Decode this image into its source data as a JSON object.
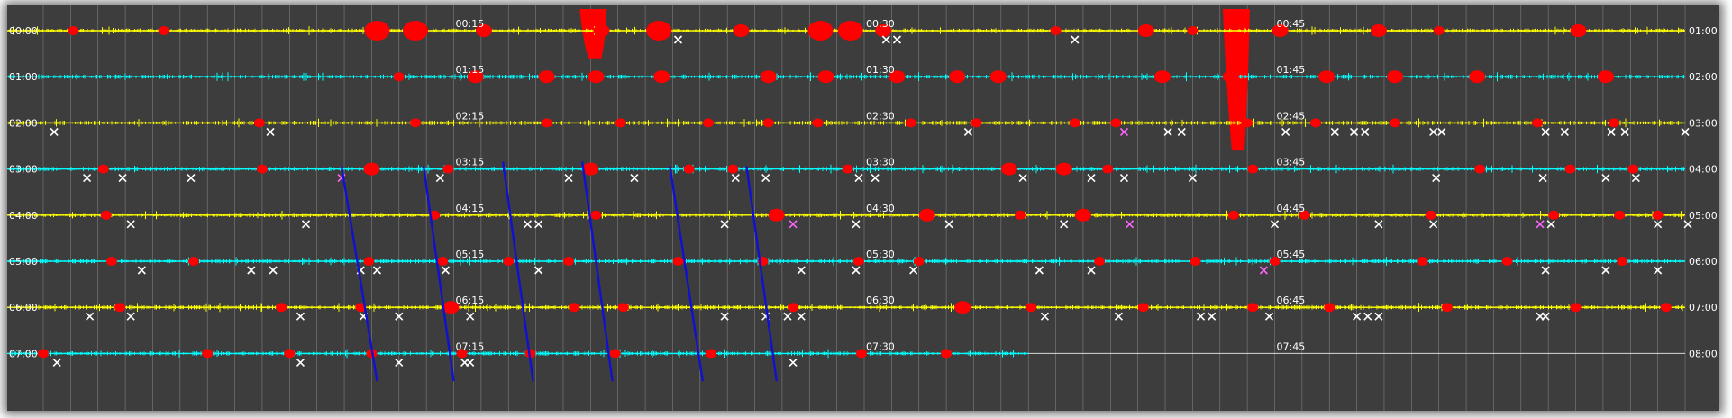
{
  "chart_data": {
    "type": "helicorder",
    "title": "",
    "left_labels": [
      "00:00",
      "01:00",
      "02:00",
      "03:00",
      "04:00",
      "05:00",
      "06:00",
      "07:00"
    ],
    "right_labels": [
      "01:00",
      "02:00",
      "03:00",
      "04:00",
      "05:00",
      "06:00",
      "07:00",
      "08:00"
    ],
    "mid_labels": [
      [
        "00:15",
        "00:30",
        "00:45"
      ],
      [
        "01:15",
        "01:30",
        "01:45"
      ],
      [
        "02:15",
        "02:30",
        "02:45"
      ],
      [
        "03:15",
        "03:30",
        "03:45"
      ],
      [
        "04:15",
        "04:30",
        "04:45"
      ],
      [
        "05:15",
        "05:30",
        "05:45"
      ],
      [
        "06:15",
        "06:30",
        "06:45"
      ],
      [
        "07:15",
        "07:30",
        "07:45"
      ]
    ],
    "minutes_per_line": 60,
    "trace_colors": [
      "#ffff00",
      "#00ffff"
    ],
    "event_color": "#ff0000",
    "pick_color": "#ffffff",
    "alt_pick_color": "#ff66ff",
    "line_color": "#1010d0",
    "background": "#3d3d3d",
    "grid": true,
    "last_line_end_minute": 36,
    "picks": [
      [
        [
          23.2,
          "w"
        ],
        [
          30.8,
          "w"
        ],
        [
          31.2,
          "w"
        ],
        [
          37.7,
          "w"
        ]
      ],
      [],
      [
        [
          0.4,
          "w"
        ],
        [
          8.3,
          "w"
        ],
        [
          33.8,
          "w"
        ],
        [
          39.5,
          "m"
        ],
        [
          41.1,
          "w"
        ],
        [
          41.6,
          "w"
        ],
        [
          45.4,
          "w"
        ],
        [
          47.2,
          "w"
        ],
        [
          47.9,
          "w"
        ],
        [
          48.3,
          "w"
        ],
        [
          50.8,
          "w"
        ],
        [
          51.1,
          "w"
        ],
        [
          54.9,
          "w"
        ],
        [
          55.6,
          "w"
        ],
        [
          57.3,
          "w"
        ],
        [
          57.8,
          "w"
        ],
        [
          60.0,
          "w"
        ]
      ],
      [
        [
          1.6,
          "w"
        ],
        [
          2.9,
          "w"
        ],
        [
          5.4,
          "w"
        ],
        [
          10.9,
          "m"
        ],
        [
          14.5,
          "w"
        ],
        [
          19.2,
          "w"
        ],
        [
          21.6,
          "w"
        ],
        [
          25.3,
          "w"
        ],
        [
          26.4,
          "w"
        ],
        [
          29.8,
          "w"
        ],
        [
          30.4,
          "w"
        ],
        [
          35.8,
          "w"
        ],
        [
          38.3,
          "w"
        ],
        [
          39.5,
          "w"
        ],
        [
          42.0,
          "w"
        ],
        [
          50.9,
          "w"
        ],
        [
          54.8,
          "w"
        ],
        [
          57.1,
          "w"
        ],
        [
          58.2,
          "w"
        ]
      ],
      [
        [
          3.2,
          "w"
        ],
        [
          9.6,
          "w"
        ],
        [
          17.7,
          "w"
        ],
        [
          18.1,
          "w"
        ],
        [
          24.9,
          "w"
        ],
        [
          27.4,
          "m"
        ],
        [
          29.7,
          "w"
        ],
        [
          33.1,
          "w"
        ],
        [
          37.3,
          "w"
        ],
        [
          39.7,
          "m"
        ],
        [
          45.0,
          "w"
        ],
        [
          48.8,
          "w"
        ],
        [
          50.8,
          "w"
        ],
        [
          54.7,
          "m"
        ],
        [
          55.1,
          "w"
        ],
        [
          59.0,
          "w"
        ],
        [
          60.1,
          "w"
        ]
      ],
      [
        [
          3.6,
          "w"
        ],
        [
          7.6,
          "w"
        ],
        [
          8.4,
          "w"
        ],
        [
          11.6,
          "w"
        ],
        [
          12.2,
          "w"
        ],
        [
          14.7,
          "w"
        ],
        [
          18.1,
          "w"
        ],
        [
          27.7,
          "w"
        ],
        [
          29.7,
          "w"
        ],
        [
          31.8,
          "w"
        ],
        [
          36.4,
          "w"
        ],
        [
          38.3,
          "w"
        ],
        [
          44.6,
          "m"
        ],
        [
          54.9,
          "w"
        ],
        [
          57.1,
          "w"
        ],
        [
          59.0,
          "w"
        ]
      ],
      [
        [
          1.7,
          "w"
        ],
        [
          3.2,
          "w"
        ],
        [
          9.4,
          "w"
        ],
        [
          11.7,
          "w"
        ],
        [
          13.0,
          "w"
        ],
        [
          15.6,
          "w"
        ],
        [
          24.9,
          "w"
        ],
        [
          26.4,
          "w"
        ],
        [
          27.2,
          "w"
        ],
        [
          27.7,
          "w"
        ],
        [
          36.6,
          "w"
        ],
        [
          39.3,
          "w"
        ],
        [
          42.3,
          "w"
        ],
        [
          42.7,
          "w"
        ],
        [
          44.8,
          "w"
        ],
        [
          48.0,
          "w"
        ],
        [
          48.4,
          "w"
        ],
        [
          48.8,
          "w"
        ],
        [
          54.7,
          "w"
        ],
        [
          54.9,
          "w"
        ]
      ],
      [
        [
          0.5,
          "w"
        ],
        [
          9.4,
          "w"
        ],
        [
          13.0,
          "w"
        ],
        [
          15.4,
          "w"
        ],
        [
          15.6,
          "w"
        ],
        [
          27.4,
          "w"
        ]
      ]
    ],
    "event_markers": [
      [
        [
          1.1,
          "s"
        ],
        [
          4.4,
          "s"
        ],
        [
          12.2,
          "l"
        ],
        [
          13.6,
          "l"
        ],
        [
          16.1,
          "m"
        ],
        [
          20.4,
          "m"
        ],
        [
          22.5,
          "l"
        ],
        [
          25.5,
          "m"
        ],
        [
          28.4,
          "l"
        ],
        [
          29.5,
          "l"
        ],
        [
          30.7,
          "m"
        ],
        [
          37.0,
          "s"
        ],
        [
          40.3,
          "m"
        ],
        [
          42.0,
          "s"
        ],
        [
          45.2,
          "m"
        ],
        [
          48.8,
          "m"
        ],
        [
          51.0,
          "s"
        ],
        [
          56.1,
          "m"
        ]
      ],
      [
        [
          13.0,
          "s"
        ],
        [
          15.8,
          "m"
        ],
        [
          18.4,
          "m"
        ],
        [
          20.2,
          "m"
        ],
        [
          22.6,
          "m"
        ],
        [
          26.5,
          "m"
        ],
        [
          28.6,
          "m"
        ],
        [
          31.2,
          "m"
        ],
        [
          33.4,
          "m"
        ],
        [
          34.9,
          "m"
        ],
        [
          40.9,
          "m"
        ],
        [
          43.4,
          "m"
        ],
        [
          46.9,
          "m"
        ],
        [
          49.4,
          "m"
        ],
        [
          52.4,
          "m"
        ],
        [
          57.1,
          "m"
        ]
      ],
      [
        [
          7.9,
          "s"
        ],
        [
          13.6,
          "s"
        ],
        [
          18.4,
          "s"
        ],
        [
          21.1,
          "s"
        ],
        [
          24.3,
          "s"
        ],
        [
          26.5,
          "s"
        ],
        [
          28.3,
          "s"
        ],
        [
          31.7,
          "s"
        ],
        [
          34.1,
          "s"
        ],
        [
          37.7,
          "s"
        ],
        [
          39.2,
          "s"
        ],
        [
          44.0,
          "s"
        ],
        [
          46.5,
          "s"
        ],
        [
          49.4,
          "s"
        ],
        [
          54.6,
          "s"
        ],
        [
          57.4,
          "s"
        ]
      ],
      [
        [
          2.2,
          "s"
        ],
        [
          8.0,
          "s"
        ],
        [
          12.0,
          "m"
        ],
        [
          14.8,
          "s"
        ],
        [
          20.0,
          "m"
        ],
        [
          23.6,
          "s"
        ],
        [
          25.2,
          "s"
        ],
        [
          29.4,
          "s"
        ],
        [
          35.3,
          "m"
        ],
        [
          37.3,
          "m"
        ],
        [
          38.9,
          "s"
        ],
        [
          44.2,
          "s"
        ],
        [
          52.5,
          "s"
        ],
        [
          55.8,
          "s"
        ],
        [
          58.1,
          "s"
        ]
      ],
      [
        [
          2.3,
          "s"
        ],
        [
          14.3,
          "s"
        ],
        [
          20.2,
          "s"
        ],
        [
          26.8,
          "m"
        ],
        [
          32.3,
          "m"
        ],
        [
          35.7,
          "s"
        ],
        [
          38.0,
          "m"
        ],
        [
          43.5,
          "s"
        ],
        [
          46.1,
          "s"
        ],
        [
          50.7,
          "s"
        ],
        [
          55.2,
          "s"
        ],
        [
          57.6,
          "s"
        ],
        [
          59.0,
          "s"
        ]
      ],
      [
        [
          2.5,
          "s"
        ],
        [
          5.5,
          "s"
        ],
        [
          11.9,
          "s"
        ],
        [
          14.6,
          "s"
        ],
        [
          17.0,
          "s"
        ],
        [
          19.2,
          "s"
        ],
        [
          23.2,
          "s"
        ],
        [
          26.3,
          "s"
        ],
        [
          29.8,
          "s"
        ],
        [
          32.0,
          "s"
        ],
        [
          38.6,
          "s"
        ],
        [
          42.1,
          "s"
        ],
        [
          45.0,
          "s"
        ],
        [
          50.4,
          "s"
        ],
        [
          53.5,
          "s"
        ],
        [
          57.7,
          "s"
        ]
      ],
      [
        [
          2.8,
          "s"
        ],
        [
          8.7,
          "s"
        ],
        [
          11.6,
          "s"
        ],
        [
          14.9,
          "m"
        ],
        [
          19.4,
          "s"
        ],
        [
          21.2,
          "s"
        ],
        [
          27.4,
          "s"
        ],
        [
          33.6,
          "m"
        ],
        [
          36.1,
          "s"
        ],
        [
          40.2,
          "s"
        ],
        [
          44.2,
          "s"
        ],
        [
          47.0,
          "s"
        ],
        [
          51.3,
          "s"
        ],
        [
          56.0,
          "s"
        ],
        [
          59.3,
          "s"
        ]
      ],
      [
        [
          0.0,
          "s"
        ],
        [
          6.0,
          "s"
        ],
        [
          9.0,
          "s"
        ],
        [
          12.0,
          "s"
        ],
        [
          15.3,
          "s"
        ],
        [
          17.8,
          "s"
        ],
        [
          20.9,
          "s"
        ],
        [
          24.4,
          "s"
        ],
        [
          29.9,
          "s"
        ],
        [
          33.0,
          "s"
        ]
      ]
    ],
    "big_events": [
      {
        "line": 0,
        "minute": 20.0,
        "height_lines": 0.6
      },
      {
        "line": 0,
        "minute": 43.5,
        "height_lines": 2.6
      }
    ],
    "annotation_lines": [
      [
        10.9,
        3.1,
        12.2,
        7.6
      ],
      [
        13.9,
        3.1,
        15.0,
        7.6
      ],
      [
        16.8,
        3.0,
        17.9,
        7.6
      ],
      [
        19.7,
        3.0,
        20.8,
        7.6
      ],
      [
        22.9,
        3.1,
        24.1,
        7.6
      ],
      [
        25.7,
        3.1,
        26.8,
        7.6
      ]
    ]
  }
}
